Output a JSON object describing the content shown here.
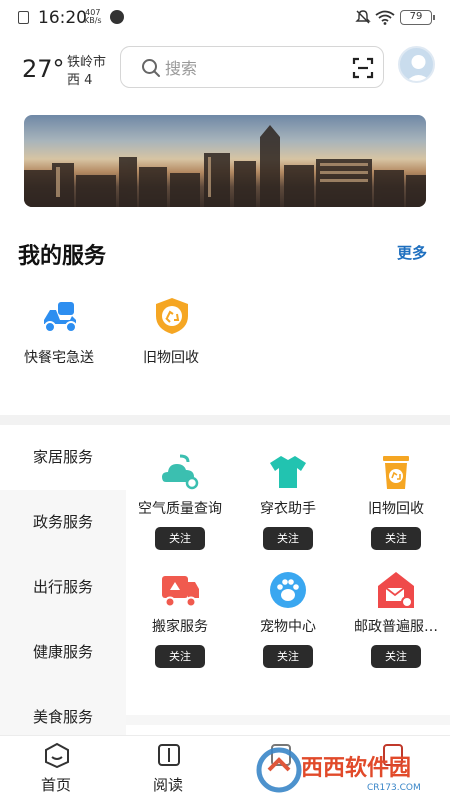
{
  "status_bar": {
    "time": "16:20",
    "speed_value": "407",
    "speed_unit": "KB/s",
    "battery": "79"
  },
  "weather": {
    "temperature": "27°",
    "city": "铁岭市",
    "wind": "西 4"
  },
  "search": {
    "placeholder": "搜索",
    "icon": "search-icon",
    "scan_icon": "scan-icon"
  },
  "my_services": {
    "title": "我的服务",
    "more": "更多",
    "items": [
      {
        "label": "快餐宅急送",
        "icon": "scooter-icon",
        "color": "#2d8ef0"
      },
      {
        "label": "旧物回收",
        "icon": "recycle-icon",
        "color": "#f5a623"
      }
    ]
  },
  "sidebar": {
    "items": [
      {
        "label": "家居服务"
      },
      {
        "label": "政务服务"
      },
      {
        "label": "出行服务"
      },
      {
        "label": "健康服务"
      },
      {
        "label": "美食服务"
      }
    ]
  },
  "grid": {
    "items": [
      {
        "label": "空气质量查询",
        "button": "关注",
        "icon": "air-quality-icon",
        "color": "#3bbfb0"
      },
      {
        "label": "穿衣助手",
        "button": "关注",
        "icon": "tshirt-icon",
        "color": "#22c3b0"
      },
      {
        "label": "旧物回收",
        "button": "关注",
        "icon": "recycle-bin-icon",
        "color": "#f5a623"
      },
      {
        "label": "搬家服务",
        "button": "关注",
        "icon": "moving-truck-icon",
        "color": "#f05a4e"
      },
      {
        "label": "宠物中心",
        "button": "关注",
        "icon": "paw-icon",
        "color": "#3aa7f0"
      },
      {
        "label": "邮政普遍服…",
        "button": "关注",
        "icon": "post-icon",
        "color": "#ef4a4a"
      }
    ]
  },
  "bottom_nav": {
    "items": [
      {
        "label": "首页",
        "icon": "home-icon"
      },
      {
        "label": "阅读",
        "icon": "book-icon"
      },
      {
        "label": "",
        "icon": "service-icon"
      },
      {
        "label": "",
        "icon": "profile-icon"
      }
    ]
  },
  "watermark": {
    "text": "西西软件园",
    "sub": "CR173.COM"
  }
}
